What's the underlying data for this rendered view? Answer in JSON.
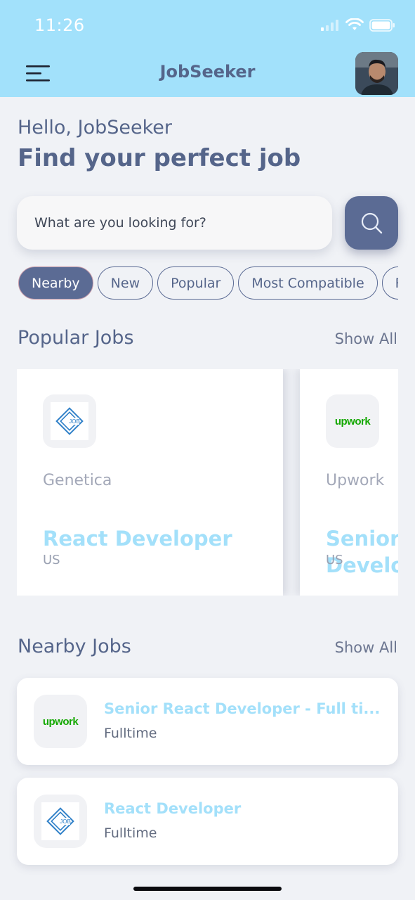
{
  "status_bar": {
    "time": "11:26"
  },
  "header": {
    "title": "JobSeeker",
    "menu_icon": "hamburger-menu-icon",
    "avatar_icon": "user-avatar"
  },
  "greeting": {
    "hello": "Hello, JobSeeker",
    "headline": "Find your perfect job"
  },
  "search": {
    "placeholder": "What are you looking for?",
    "button_icon": "search-icon"
  },
  "filters": [
    {
      "label": "Nearby",
      "active": true
    },
    {
      "label": "New",
      "active": false
    },
    {
      "label": "Popular",
      "active": false
    },
    {
      "label": "Most Compatible",
      "active": false
    },
    {
      "label": "R",
      "active": false
    }
  ],
  "popular_jobs": {
    "title": "Popular Jobs",
    "show_all": "Show All",
    "cards": [
      {
        "company": "Genetica",
        "role": "React Developer",
        "location": "US",
        "logo": "job-logo"
      },
      {
        "company": "Upwork",
        "role_line1": "Senior R",
        "role_line2": "Develop",
        "location": "US",
        "logo": "upwork-logo",
        "logo_text": "upwork"
      }
    ]
  },
  "nearby_jobs": {
    "title": "Nearby Jobs",
    "show_all": "Show All",
    "items": [
      {
        "title": "Senior React Developer - Full ti...",
        "type": "Fulltime",
        "logo": "upwork-logo",
        "logo_text": "upwork"
      },
      {
        "title": "React Developer",
        "type": "Fulltime",
        "logo": "job-logo",
        "logo_text": "JOB"
      }
    ]
  },
  "colors": {
    "header_bg": "#a2e1fb",
    "primary": "#5b6b94",
    "accent_text": "#a3e0fa",
    "upwork_green": "#14a800"
  }
}
